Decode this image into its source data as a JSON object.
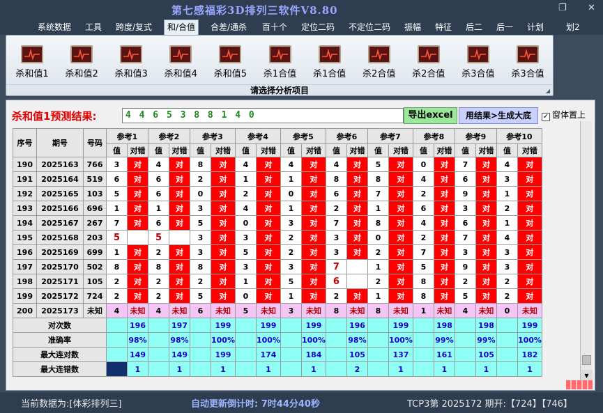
{
  "app": {
    "title": "第七感福彩3D排列三软件V8.80"
  },
  "menu": {
    "items": [
      "系统数据",
      "工具",
      "跨度/复式",
      "和/合值",
      "合差/通杀",
      "百十个",
      "定位二码",
      "不定位二码",
      "振幅",
      "特征",
      "后二",
      "后一",
      "计划",
      "划2"
    ],
    "active_index": 3
  },
  "ribbon": {
    "buttons": [
      "杀和值1",
      "杀和值2",
      "杀和值3",
      "杀和值4",
      "杀和值5",
      "杀1合值",
      "杀1合值",
      "杀2合值",
      "杀2合值",
      "杀3合值",
      "杀3合值"
    ],
    "caption": "请选择分析项目"
  },
  "prediction": {
    "label": "杀和值1预测结果:",
    "value": "4 4 6 5 3 8 8 1 4 0",
    "export_label": "导出excel",
    "generate_label": "用结果>生成大底",
    "ontop_label": "窗体置上",
    "ontop_checked": "✓"
  },
  "grid": {
    "col_seq": "序号",
    "col_period": "期号",
    "col_code": "号码",
    "ref_labels": [
      "参考1",
      "参考2",
      "参考3",
      "参考4",
      "参考5",
      "参考6",
      "参考7",
      "参考8",
      "参考9",
      "参考10"
    ],
    "sub_value": "值",
    "sub_result": "对错",
    "ok_text": "对",
    "rows": [
      {
        "seq": "190",
        "period": "2025163",
        "code": "766",
        "vals": [
          "3",
          "4",
          "8",
          "4",
          "4",
          "4",
          "5",
          "0",
          "7",
          "4"
        ],
        "miss": []
      },
      {
        "seq": "191",
        "period": "2025164",
        "code": "519",
        "vals": [
          "6",
          "6",
          "2",
          "1",
          "1",
          "8",
          "8",
          "4",
          "6",
          "3"
        ],
        "miss": []
      },
      {
        "seq": "192",
        "period": "2025165",
        "code": "103",
        "vals": [
          "5",
          "6",
          "0",
          "2",
          "0",
          "6",
          "7",
          "2",
          "9",
          "1"
        ],
        "miss": []
      },
      {
        "seq": "193",
        "period": "2025166",
        "code": "696",
        "vals": [
          "1",
          "1",
          "3",
          "4",
          "1",
          "2",
          "1",
          "6",
          "3",
          "2"
        ],
        "miss": []
      },
      {
        "seq": "194",
        "period": "2025167",
        "code": "267",
        "vals": [
          "7",
          "6",
          "5",
          "0",
          "3",
          "7",
          "8",
          "4",
          "6",
          "1"
        ],
        "miss": []
      },
      {
        "seq": "195",
        "period": "2025168",
        "code": "203",
        "vals": [
          "5",
          "5",
          "3",
          "3",
          "2",
          "3",
          "0",
          "2",
          "7",
          "4"
        ],
        "miss": [
          0,
          1
        ]
      },
      {
        "seq": "196",
        "period": "2025169",
        "code": "699",
        "vals": [
          "1",
          "2",
          "3",
          "5",
          "2",
          "3",
          "2",
          "7",
          "3",
          "3"
        ],
        "miss": []
      },
      {
        "seq": "197",
        "period": "2025170",
        "code": "502",
        "vals": [
          "8",
          "8",
          "8",
          "3",
          "3",
          "7",
          "1",
          "5",
          "9",
          "3"
        ],
        "miss": [
          5
        ]
      },
      {
        "seq": "198",
        "period": "2025171",
        "code": "105",
        "vals": [
          "2",
          "2",
          "2",
          "1",
          "5",
          "6",
          "2",
          "8",
          "2",
          "2"
        ],
        "miss": [
          5
        ]
      },
      {
        "seq": "199",
        "period": "2025172",
        "code": "724",
        "vals": [
          "2",
          "2",
          "5",
          "0",
          "1",
          "2",
          "1",
          "8",
          "5",
          "2"
        ],
        "miss": []
      },
      {
        "seq": "200",
        "period": "2025173",
        "code": "未知",
        "vals": [
          "4",
          "4",
          "6",
          "5",
          "3",
          "8",
          "8",
          "1",
          "4",
          "0"
        ],
        "miss": [],
        "unknown": true
      }
    ],
    "unknown_text": "未知",
    "stats": [
      {
        "label": "对次数",
        "values": [
          "196",
          "197",
          "199",
          "199",
          "199",
          "196",
          "199",
          "198",
          "198",
          "199"
        ]
      },
      {
        "label": "准确率",
        "values": [
          "98%",
          "98%",
          "100%",
          "100%",
          "100%",
          "98%",
          "100%",
          "99%",
          "99%",
          "100%"
        ]
      },
      {
        "label": "最大连对数",
        "values": [
          "149",
          "149",
          "199",
          "174",
          "184",
          "105",
          "137",
          "161",
          "105",
          "182"
        ]
      },
      {
        "label": "最大连错数",
        "values": [
          "1",
          "1",
          "1",
          "1",
          "1",
          "2",
          "1",
          "1",
          "1",
          "1"
        ]
      }
    ]
  },
  "status": {
    "data_label": "当前数据为:[体彩排列三]",
    "timer_label": "自动更新倒计时:  7时44分40秒",
    "tcp_label": "TCP3第 2025172 期开:【724】【746】"
  },
  "colors": {
    "ok": "#ff0000",
    "stat": "#8ffff5",
    "unknown": "#f5c6f5",
    "predict_text": "#1a8a1a"
  }
}
